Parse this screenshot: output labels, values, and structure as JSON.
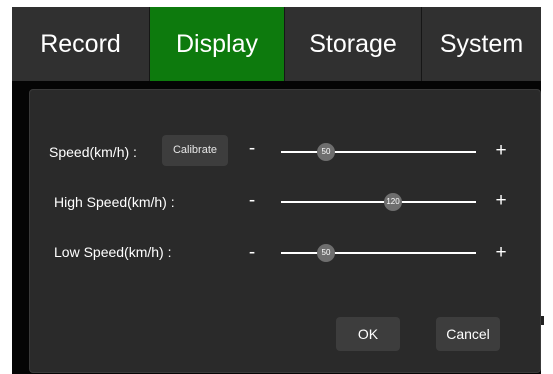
{
  "tabs": [
    {
      "label": "Record",
      "active": false
    },
    {
      "label": "Display",
      "active": true
    },
    {
      "label": "Storage",
      "active": false
    },
    {
      "label": "System",
      "active": false
    }
  ],
  "settings": {
    "speed": {
      "label": "Speed(km/h) :",
      "calibrate_label": "Calibrate",
      "value": "50",
      "minus": "-",
      "plus": "+"
    },
    "high_speed": {
      "label": "High Speed(km/h) :",
      "value": "120",
      "minus": "-",
      "plus": "+"
    },
    "low_speed": {
      "label": "Low Speed(km/h) :",
      "value": "50",
      "minus": "-",
      "plus": "+"
    }
  },
  "buttons": {
    "ok": "OK",
    "cancel": "Cancel"
  },
  "colors": {
    "active_tab": "#0d7a0d",
    "tab": "#303030",
    "panel": "#2a2a2a",
    "background": "#050505"
  }
}
